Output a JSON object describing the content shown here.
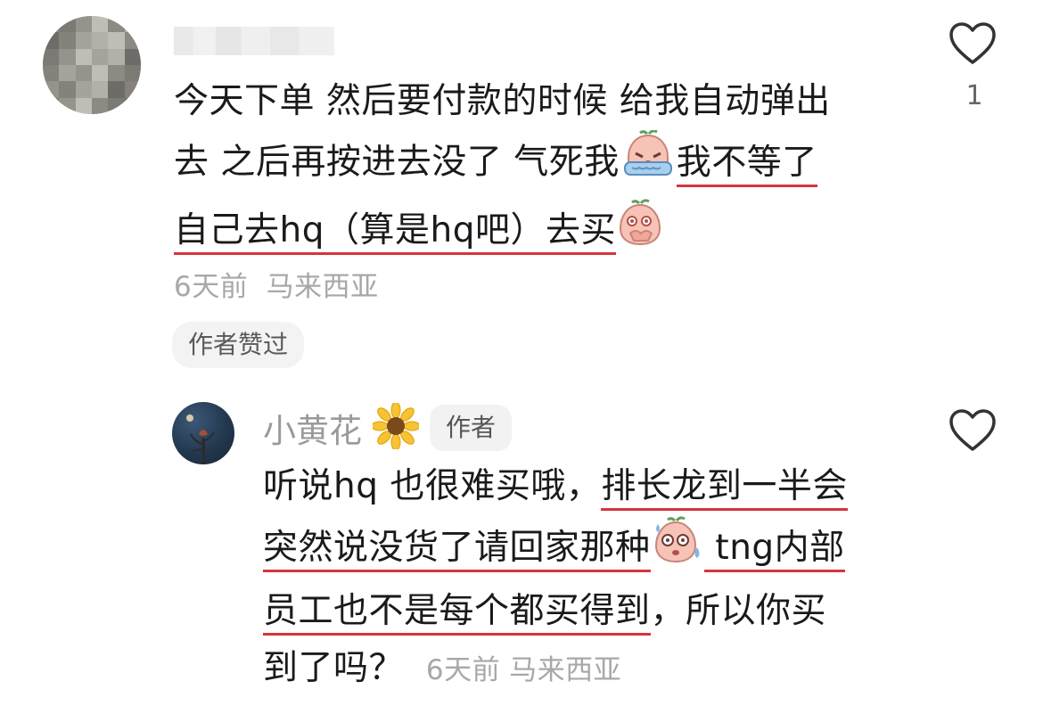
{
  "comment": {
    "line1": "今天下单 然后要付款的时候 给我自动弹出",
    "line2_a": "去 之后再按进去没了 气死我",
    "line2_b": "我不等了",
    "line3_a": "自己去hq（算是hq吧）去买",
    "time": "6天前",
    "location": "马来西亚",
    "author_liked_label": "作者赞过",
    "like_count": "1",
    "emoji_1": "crying-face",
    "emoji_2": "covering-mouth-face"
  },
  "reply": {
    "name": "小黄花",
    "author_badge": "作者",
    "line1_a": "听说hq 也很难买哦，",
    "line1_b": "排长龙到一半会",
    "line2_a": "突然说没货了请回家那种",
    "line2_b": " tng内部",
    "line3_a": "员工也不是每个都买得到",
    "line3_b": "，所以你买",
    "line4": "到了吗？",
    "time": "6天前",
    "location": "马来西亚",
    "emoji": "sweating-face"
  },
  "colors": {
    "underline": "#d6343e",
    "text": "#1a1a1a",
    "meta": "#a8a8a8"
  }
}
